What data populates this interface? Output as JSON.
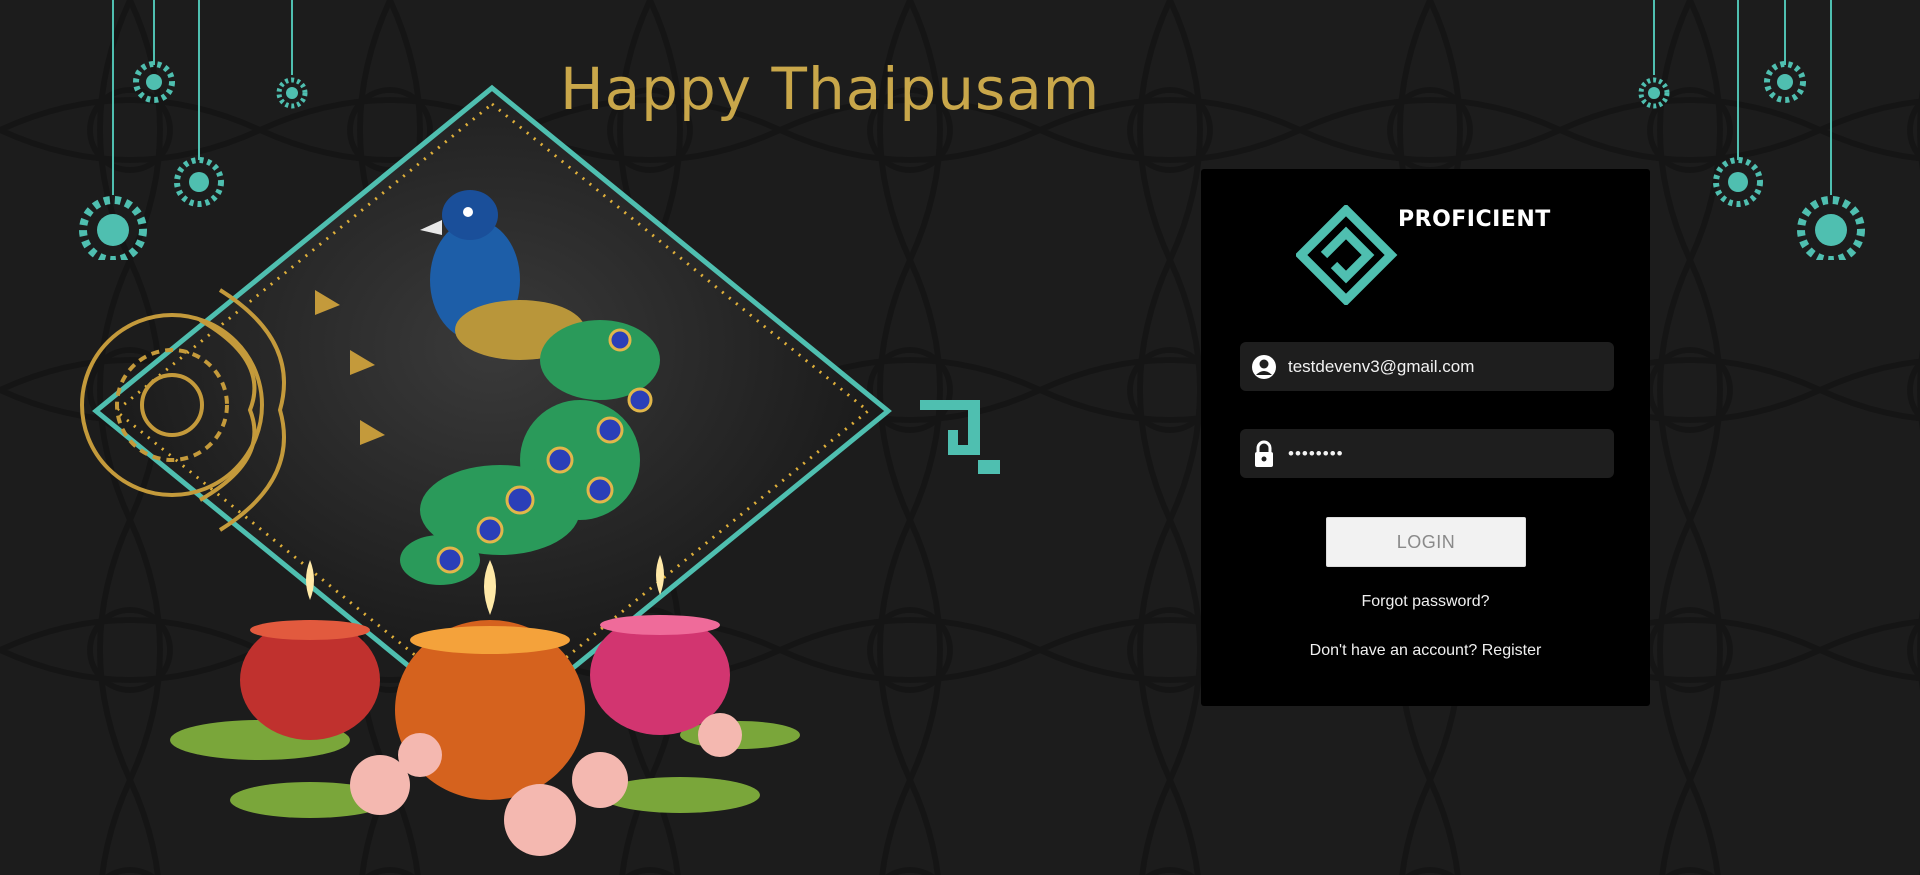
{
  "banner": {
    "title": "Happy Thaipusam"
  },
  "brand": {
    "name": "PROFICIENT",
    "logo_icon": "proficient-logo-icon"
  },
  "login_form": {
    "email": {
      "value": "testdevenv3@gmail.com",
      "icon": "user-circle-icon"
    },
    "password": {
      "value": "••••••••",
      "icon": "lock-icon"
    },
    "login_button": "LOGIN",
    "forgot_password": "Forgot password?",
    "no_account_text": "Don't have an account?",
    "register_link": "Register"
  },
  "colors": {
    "background": "#1c1c1c",
    "card": "#000000",
    "title_gold": "#c9a74a",
    "teal_accent": "#4fbfb0",
    "field_bg": "#1e1e1e",
    "button_bg": "#f2f2f2"
  }
}
